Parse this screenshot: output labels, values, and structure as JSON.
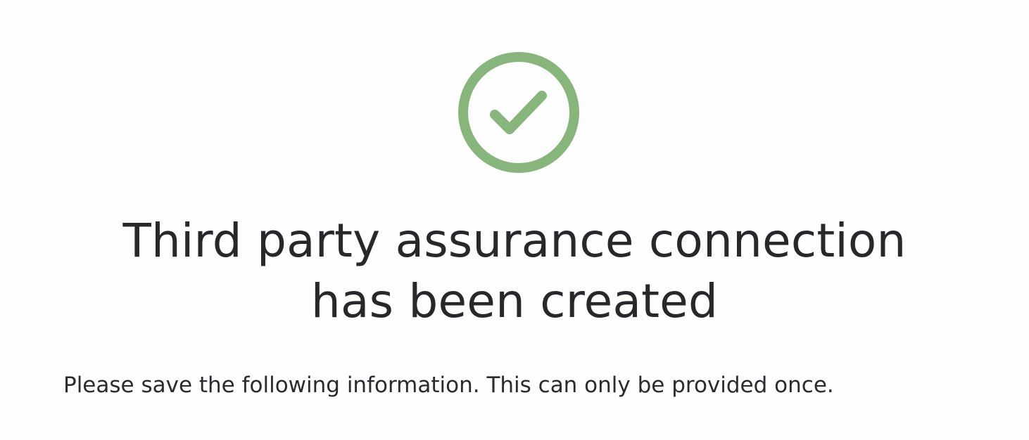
{
  "success": {
    "icon": "check-circle-icon",
    "icon_color": "#87b57c"
  },
  "heading": {
    "line1": "Third party assurance connection",
    "line2": "has been created"
  },
  "message": "Please save the following information. This can only be provided once."
}
